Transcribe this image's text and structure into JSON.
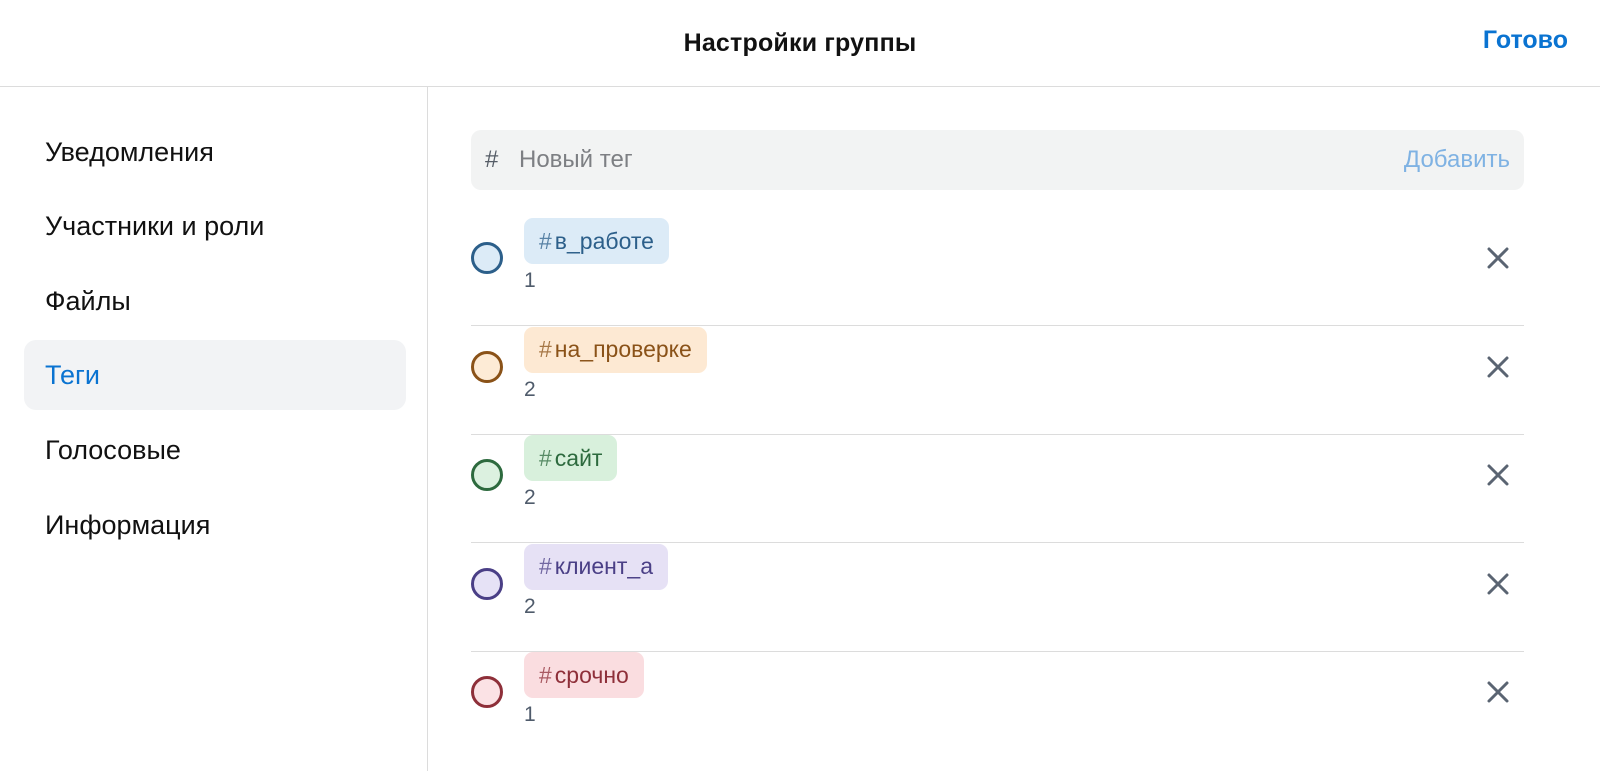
{
  "header": {
    "title": "Настройки группы",
    "done_label": "Готово"
  },
  "sidebar": {
    "items": [
      {
        "label": "Уведомления"
      },
      {
        "label": "Участники и роли"
      },
      {
        "label": "Файлы"
      },
      {
        "label": "Теги",
        "active": true
      },
      {
        "label": "Голосовые"
      },
      {
        "label": "Информация"
      }
    ]
  },
  "tag_input": {
    "hash": "#",
    "placeholder": "Новый тег",
    "value": "",
    "add_label": "Добавить"
  },
  "tags": [
    {
      "hash": "#",
      "name": "в_работе",
      "count": "1",
      "color": "#2c5f8a",
      "bg": "#dcebf7",
      "fill": "#dcebf7"
    },
    {
      "hash": "#",
      "name": "на_проверке",
      "count": "2",
      "color": "#8a5218",
      "bg": "#fde9d3",
      "fill": "#fdebd6"
    },
    {
      "hash": "#",
      "name": "сайт",
      "count": "2",
      "color": "#2d6a3e",
      "bg": "#d8f0dc",
      "fill": "#dcf1e0"
    },
    {
      "hash": "#",
      "name": "клиент_а",
      "count": "2",
      "color": "#4a3f86",
      "bg": "#e6e1f5",
      "fill": "#e6e2f6"
    },
    {
      "hash": "#",
      "name": "срочно",
      "count": "1",
      "color": "#8e2f39",
      "bg": "#fadde0",
      "fill": "#fbe2e5"
    }
  ],
  "icons": {
    "remove": "close-icon",
    "hash": "hash-icon"
  },
  "colors": {
    "accent": "#0a73d1",
    "add_disabled": "#7fb2e3",
    "active_bg": "#f2f3f5"
  }
}
